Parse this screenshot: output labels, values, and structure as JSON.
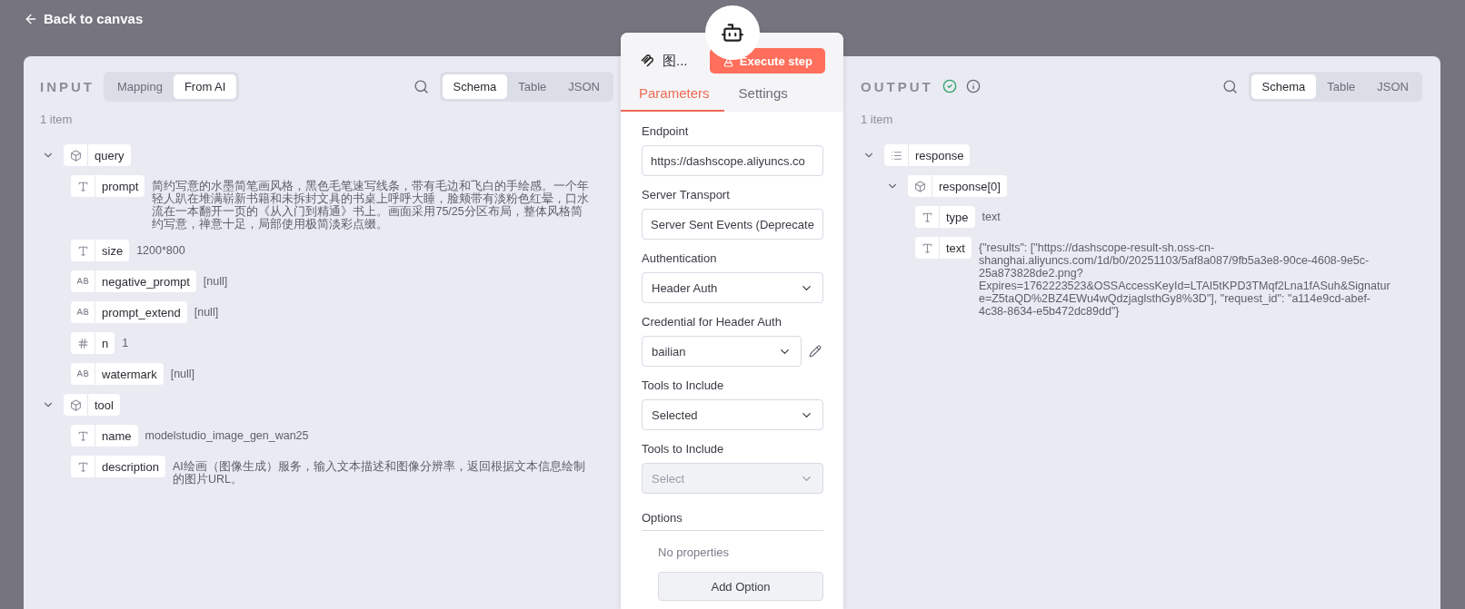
{
  "header": {
    "back_label": "Back to canvas"
  },
  "input": {
    "title": "INPUT",
    "modes": [
      {
        "label": "Mapping",
        "selected": false
      },
      {
        "label": "From AI",
        "selected": true
      }
    ],
    "views": [
      {
        "label": "Schema",
        "selected": true
      },
      {
        "label": "Table",
        "selected": false
      },
      {
        "label": "JSON",
        "selected": false
      }
    ],
    "count": "1 item",
    "tree": [
      {
        "kind": "object",
        "key": "query",
        "expanded": true,
        "children": [
          {
            "kind": "string",
            "key": "prompt",
            "value": "简约写意的水墨简笔画风格，黑色毛笔速写线条，带有毛边和飞白的手绘感。一个年轻人趴在堆满崭新书籍和未拆封文具的书桌上呼呼大睡，脸颊带有淡粉色红晕，口水流在一本翻开一页的《从入门到精通》书上。画面采用75/25分区布局，整体风格简约写意，禅意十足，局部使用极简淡彩点缀。"
          },
          {
            "kind": "string",
            "key": "size",
            "value": "1200*800"
          },
          {
            "kind": "null",
            "key": "negative_prompt",
            "value": "[null]"
          },
          {
            "kind": "null",
            "key": "prompt_extend",
            "value": "[null]"
          },
          {
            "kind": "number",
            "key": "n",
            "value": "1"
          },
          {
            "kind": "null",
            "key": "watermark",
            "value": "[null]"
          }
        ]
      },
      {
        "kind": "object",
        "key": "tool",
        "expanded": true,
        "children": [
          {
            "kind": "string",
            "key": "name",
            "value": "modelstudio_image_gen_wan25"
          },
          {
            "kind": "string",
            "key": "description",
            "value": "AI绘画（图像生成）服务，输入文本描述和图像分辨率，返回根据文本信息绘制的图片URL。"
          }
        ]
      }
    ]
  },
  "node": {
    "title": "图...",
    "execute_label": "Execute step",
    "tabs": [
      {
        "label": "Parameters",
        "selected": true
      },
      {
        "label": "Settings",
        "selected": false
      }
    ],
    "fields": [
      {
        "kind": "text",
        "label": "Endpoint",
        "value": "https://dashscope.aliyuncs.co"
      },
      {
        "kind": "text",
        "label": "Server Transport",
        "value": "Server Sent Events (Deprecate"
      },
      {
        "kind": "select",
        "label": "Authentication",
        "value": "Header Auth",
        "disabled": false
      },
      {
        "kind": "credential",
        "label": "Credential for Header Auth",
        "value": "bailian",
        "disabled": false
      },
      {
        "kind": "select",
        "label": "Tools to Include",
        "value": "Selected",
        "disabled": false
      },
      {
        "kind": "select",
        "label": "Tools to Include",
        "placeholder": "Select",
        "disabled": true
      }
    ],
    "options": {
      "label": "Options",
      "empty_text": "No properties",
      "add_label": "Add Option"
    }
  },
  "output": {
    "title": "OUTPUT",
    "success": true,
    "views": [
      {
        "label": "Schema",
        "selected": true
      },
      {
        "label": "Table",
        "selected": false
      },
      {
        "label": "JSON",
        "selected": false
      }
    ],
    "count": "1 item",
    "tree": [
      {
        "kind": "array",
        "key": "response",
        "expanded": true,
        "children": [
          {
            "kind": "object",
            "key": "response[0]",
            "expanded": true,
            "children": [
              {
                "kind": "string",
                "key": "type",
                "value": "text"
              },
              {
                "kind": "string",
                "key": "text",
                "value": "{\"results\": [\"https://dashscope-result-sh.oss-cn-shanghai.aliyuncs.com/1d/b0/20251103/5af8a087/9fb5a3e8-90ce-4608-9e5c-25a873828de2.png?Expires=1762223523&OSSAccessKeyId=LTAI5tKPD3TMqf2Lna1fASuh&Signature=Z5taQD%2BZ4EWu4wQdzjaglsthGy8%3D\"], \"request_id\": \"a114e9cd-abef-4c38-8634-e5b472dc89dd\"}"
              }
            ]
          }
        ]
      }
    ]
  }
}
